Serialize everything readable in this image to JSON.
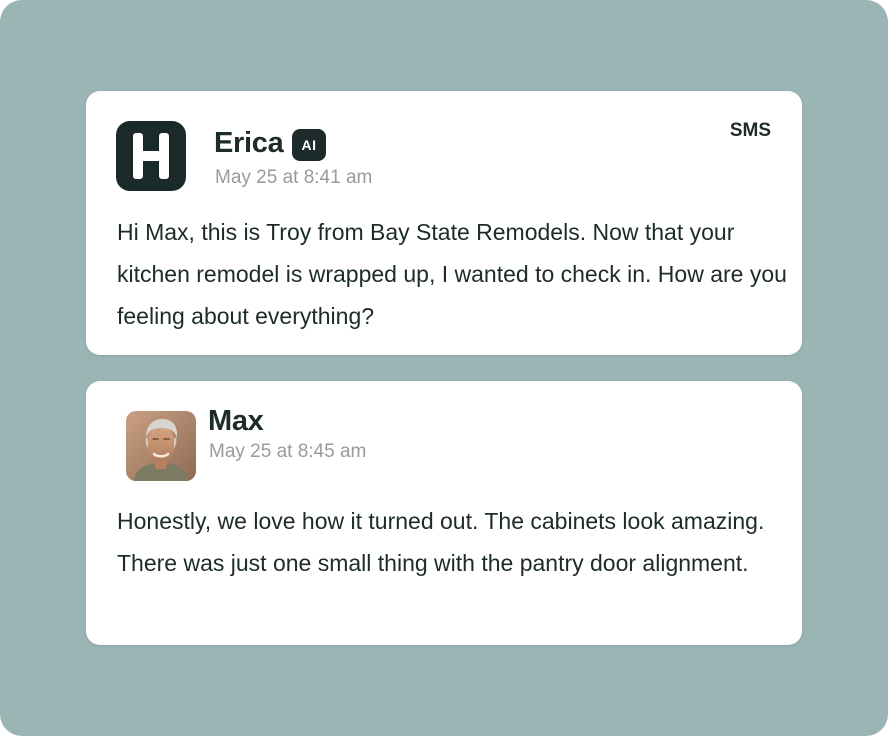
{
  "messages": [
    {
      "sender": "Erica",
      "badge": "AI",
      "timestamp": "May 25 at 8:41 am",
      "channel": "SMS",
      "avatar_icon": "h-logo-icon",
      "text": "Hi Max, this is Troy from Bay State Remodels. Now that your kitchen remodel is wrapped up, I  wanted to check in. How are you feeling about everything?"
    },
    {
      "sender": "Max",
      "timestamp": "May 25 at 8:45 am",
      "avatar_icon": "user-photo",
      "text": "Honestly, we love how it turned out. The cabinets look amazing. There was just one small thing with the pantry door alignment."
    }
  ],
  "colors": {
    "background": "#9bb4b4",
    "card": "#ffffff",
    "text": "#1d2b2b",
    "muted": "#9a9a9a"
  }
}
